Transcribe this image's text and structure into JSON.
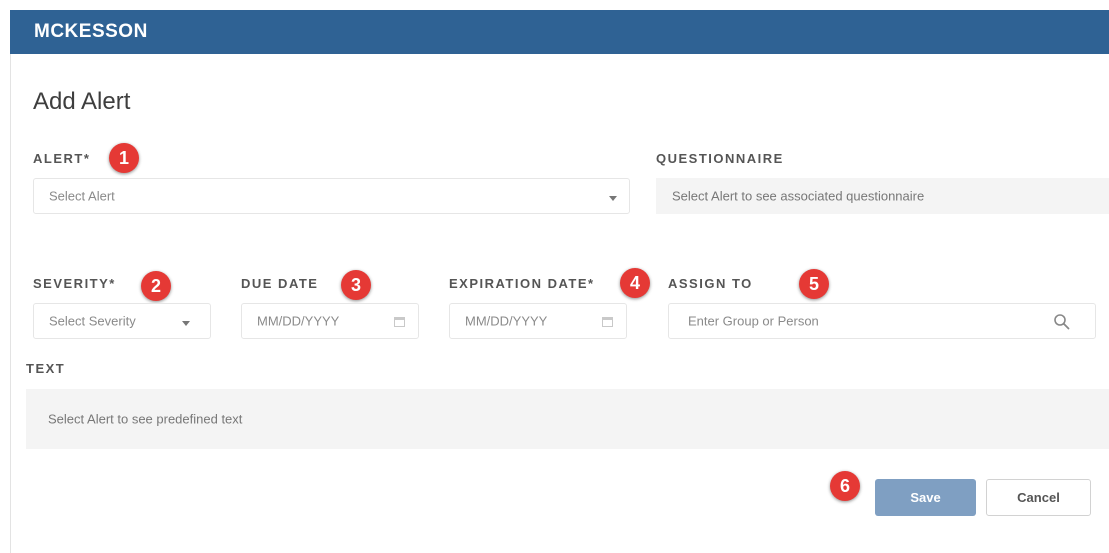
{
  "header": {
    "brand": "MCKESSON"
  },
  "page": {
    "title": "Add Alert"
  },
  "form": {
    "alert": {
      "label": "ALERT*",
      "placeholder": "Select Alert",
      "badge": "1"
    },
    "questionnaire": {
      "label": "QUESTIONNAIRE",
      "placeholder": "Select Alert to see associated questionnaire"
    },
    "severity": {
      "label": "SEVERITY*",
      "placeholder": "Select Severity",
      "badge": "2"
    },
    "due_date": {
      "label": "DUE DATE",
      "placeholder": "MM/DD/YYYY",
      "badge": "3"
    },
    "expiration_date": {
      "label": "EXPIRATION DATE*",
      "placeholder": "MM/DD/YYYY",
      "badge": "4"
    },
    "assign_to": {
      "label": "ASSIGN TO",
      "placeholder": "Enter Group or Person",
      "badge": "5"
    },
    "text": {
      "label": "TEXT",
      "placeholder": "Select Alert to see predefined text"
    }
  },
  "actions": {
    "save_label": "Save",
    "cancel_label": "Cancel",
    "badge": "6"
  },
  "icons": {
    "caret": "chevron-down-icon",
    "calendar": "calendar-icon",
    "search": "search-icon"
  },
  "colors": {
    "header": "#2f6294",
    "badge": "#e53935",
    "save_button": "#7f9fc2"
  }
}
